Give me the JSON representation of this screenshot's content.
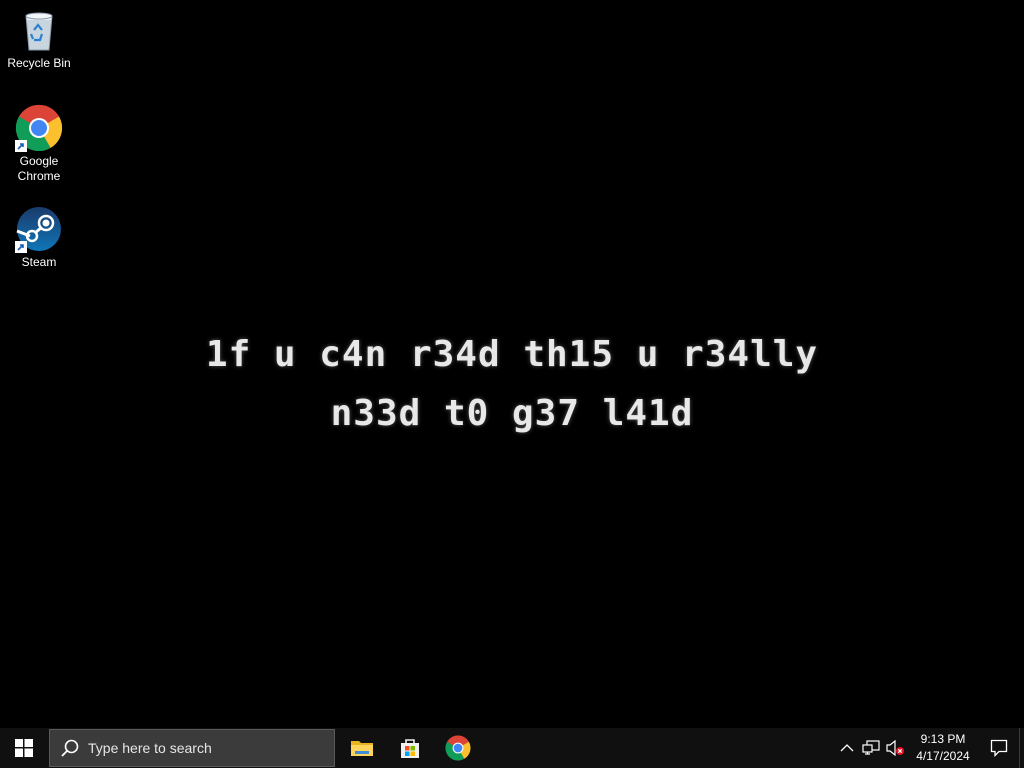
{
  "desktop": {
    "background_color": "#000000",
    "icons": [
      {
        "label": "Recycle Bin",
        "icon": "recycle-bin-icon"
      },
      {
        "label": "Google Chrome",
        "icon": "chrome-icon"
      },
      {
        "label": "Steam",
        "icon": "steam-icon"
      }
    ],
    "wallpaper_text": {
      "line1": "1f u c4n r34d th15 u r34lly",
      "line2": "n33d t0 g37 l41d"
    }
  },
  "taskbar": {
    "start_icon": "windows-start-icon",
    "search": {
      "placeholder": "Type here to search",
      "icon": "search-icon"
    },
    "pinned": [
      {
        "name": "File Explorer",
        "icon": "file-explorer-icon"
      },
      {
        "name": "Microsoft Store",
        "icon": "store-icon"
      },
      {
        "name": "Google Chrome",
        "icon": "chrome-icon"
      }
    ],
    "tray": {
      "icons": [
        "chevron-up-icon",
        "network-icon",
        "volume-muted-icon"
      ],
      "time": "9:13 PM",
      "date": "4/17/2024",
      "notification_icon": "action-center-icon"
    }
  }
}
